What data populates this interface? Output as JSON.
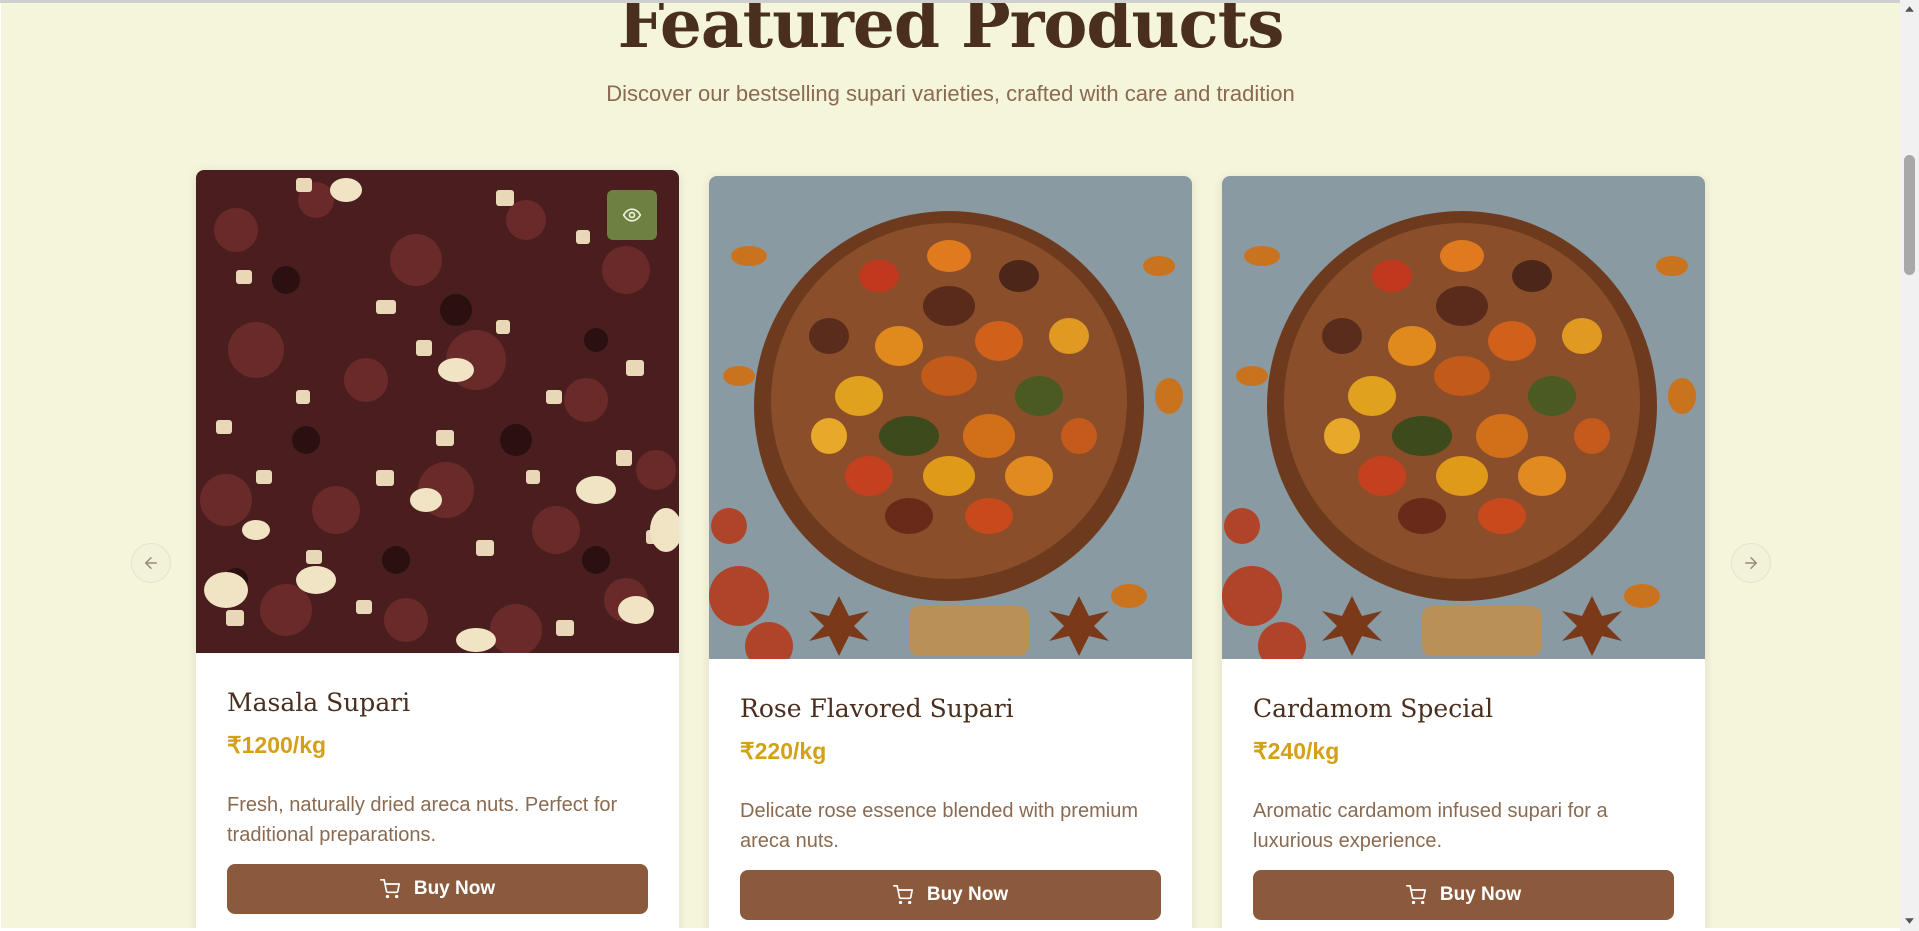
{
  "section": {
    "title": "Featured Products",
    "subtitle": "Discover our bestselling supari varieties, crafted with care and tradition"
  },
  "products": [
    {
      "name": "Masala Supari",
      "price": "₹1200/kg",
      "description": "Fresh, naturally dried areca nuts. Perfect for traditional preparations.",
      "button_label": "Buy Now"
    },
    {
      "name": "Rose Flavored Supari",
      "price": "₹220/kg",
      "description": "Delicate rose essence blended with premium areca nuts.",
      "button_label": "Buy Now"
    },
    {
      "name": "Cardamom Special",
      "price": "₹240/kg",
      "description": "Aromatic cardamom infused supari for a luxurious experience.",
      "button_label": "Buy Now"
    }
  ],
  "icons": {
    "prev": "arrow-left-icon",
    "next": "arrow-right-icon",
    "quick_view": "eye-icon",
    "cart": "cart-icon"
  },
  "colors": {
    "background": "#f5f5dc",
    "heading": "#4a2f1e",
    "price": "#d4a017",
    "button": "#8b5a3c",
    "quick_view": "#708c46"
  }
}
